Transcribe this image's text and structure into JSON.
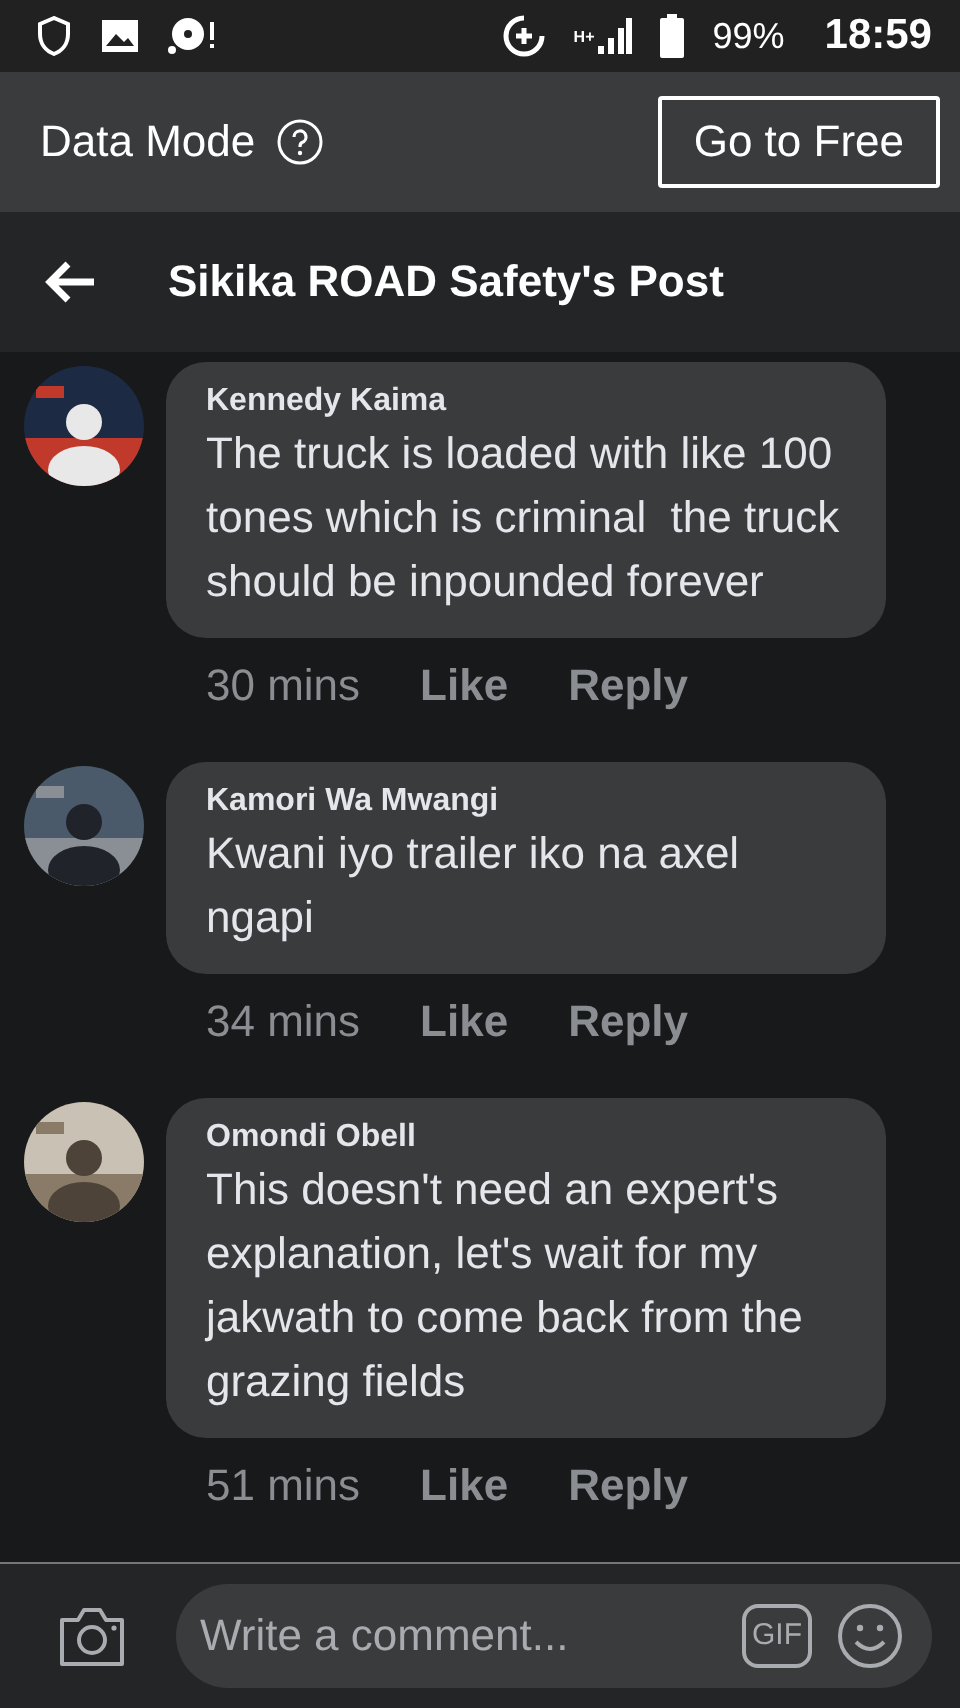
{
  "status_bar": {
    "network": "H+",
    "battery": "99%",
    "time": "18:59"
  },
  "data_mode": {
    "label": "Data Mode",
    "button": "Go to Free"
  },
  "header": {
    "title": "Sikika ROAD Safety's Post"
  },
  "comments": [
    {
      "author": "Kennedy Kaima",
      "text": "The truck is loaded with like 100 tones which is criminal  the truck should be inpounded forever",
      "time": "30 mins",
      "actions": [
        "Like",
        "Reply"
      ],
      "avatar": {
        "kind": "picture"
      }
    },
    {
      "author": "Kamori Wa Mwangi",
      "text": "Kwani iyo trailer iko na axel ngapi",
      "time": "34 mins",
      "actions": [
        "Like",
        "Reply"
      ],
      "avatar": {
        "kind": "picture"
      }
    },
    {
      "author": "Omondi Obell",
      "text": "This doesn't need an expert's explanation, let's wait for my jakwath to come back from the grazing fields",
      "time": "51 mins",
      "actions": [
        "Like",
        "Reply"
      ],
      "avatar": {
        "kind": "picture"
      }
    }
  ],
  "composer": {
    "placeholder": "Write a comment...",
    "gif_label": "GIF"
  }
}
